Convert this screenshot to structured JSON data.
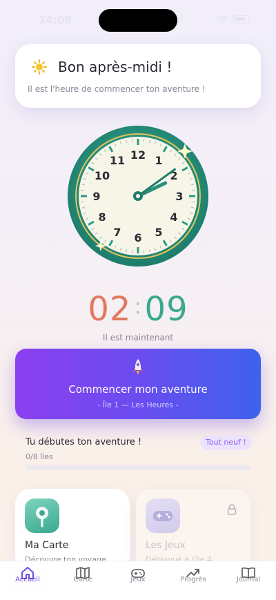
{
  "status": {
    "time": "14:09"
  },
  "greeting": {
    "title": "Bon après-midi !",
    "subtitle": "Il est l'heure de commencer ton aventure !"
  },
  "clock": {
    "numbers": [
      "12",
      "1",
      "2",
      "3",
      "4",
      "5",
      "6",
      "7",
      "8",
      "9",
      "10",
      "11"
    ],
    "hour": 2,
    "minute": 9
  },
  "time": {
    "hours": "02",
    "separator": ":",
    "minutes": "09",
    "label": "Il est maintenant"
  },
  "start_button": {
    "title": "Commencer mon aventure",
    "subtitle": "- Île 1 — Les Heures -"
  },
  "progress": {
    "title": "Tu débutes ton aventure !",
    "badge": "Tout neuf !",
    "count": "0/8 îles",
    "fraction": 0
  },
  "cards": {
    "map": {
      "title": "Ma Carte",
      "subtitle": "Découvre ton voyage"
    },
    "games": {
      "title": "Les Jeux",
      "subtitle": "Débloqué à l'île 4",
      "locked": true
    }
  },
  "tabs": [
    {
      "label": "Accueil",
      "icon": "home-icon",
      "active": true
    },
    {
      "label": "Carte",
      "icon": "map-icon",
      "active": false
    },
    {
      "label": "Jeux",
      "icon": "gamepad-icon",
      "active": false
    },
    {
      "label": "Progrès",
      "icon": "trend-icon",
      "active": false
    },
    {
      "label": "Journal",
      "icon": "book-icon",
      "active": false
    }
  ],
  "colors": {
    "accent": "#6b4ce6",
    "teal": "#3aa88f",
    "coral": "#e07a5f"
  }
}
